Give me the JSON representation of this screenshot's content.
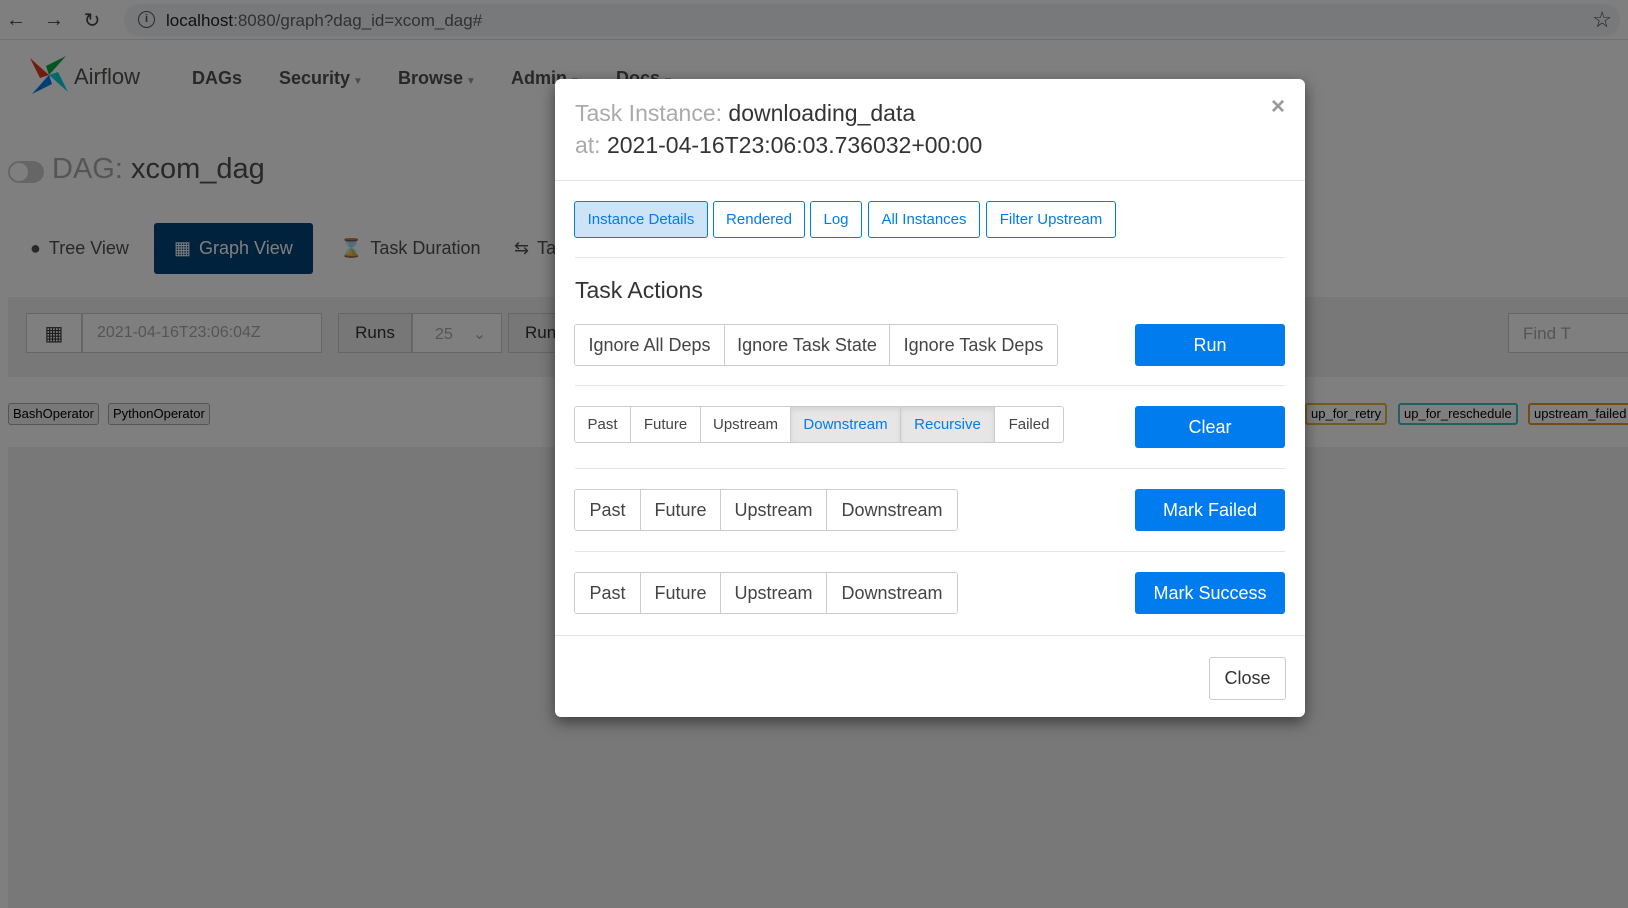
{
  "browser": {
    "url_host": "localhost",
    "url_rest": ":8080/graph?dag_id=xcom_dag#",
    "info_glyph": "i"
  },
  "navbar": {
    "brand": "Airflow",
    "items": [
      {
        "label": "DAGs",
        "dropdown": false
      },
      {
        "label": "Security",
        "dropdown": true
      },
      {
        "label": "Browse",
        "dropdown": true
      },
      {
        "label": "Admin",
        "dropdown": true
      },
      {
        "label": "Docs",
        "dropdown": true
      }
    ]
  },
  "dag": {
    "title_label": "DAG:",
    "title_value": "xcom_dag",
    "views": [
      {
        "label": "Tree View",
        "icon": "tree-icon"
      },
      {
        "label": "Graph View",
        "icon": "graph-icon"
      },
      {
        "label": "Task Duration",
        "icon": "hourglass-icon"
      },
      {
        "label": "Ta",
        "icon": "retry-icon"
      }
    ],
    "date_value": "2021-04-16T23:06:04Z",
    "runs_label": "Runs",
    "runs_value": "25",
    "run_label": "Run",
    "find_placeholder": "Find T",
    "operators": [
      "BashOperator",
      "PythonOperator"
    ],
    "states": [
      {
        "label": "up_for_retry",
        "color": "#e8b43a"
      },
      {
        "label": "up_for_reschedule",
        "color": "#40c0c0"
      },
      {
        "label": "upstream_failed",
        "color": "#e39a2a"
      }
    ]
  },
  "modal": {
    "title_label": "Task Instance:",
    "title_value": "downloading_data",
    "at_label": "at:",
    "at_value": "2021-04-16T23:06:03.736032+00:00",
    "close_x": "×",
    "tabs": [
      "Instance Details",
      "Rendered",
      "Log",
      "All Instances",
      "Filter Upstream"
    ],
    "section_title": "Task Actions",
    "run_options": [
      "Ignore All Deps",
      "Ignore Task State",
      "Ignore Task Deps"
    ],
    "run_label": "Run",
    "clear_options": [
      "Past",
      "Future",
      "Upstream",
      "Downstream",
      "Recursive",
      "Failed"
    ],
    "clear_label": "Clear",
    "failed_options": [
      "Past",
      "Future",
      "Upstream",
      "Downstream"
    ],
    "failed_label": "Mark Failed",
    "success_options": [
      "Past",
      "Future",
      "Upstream",
      "Downstream"
    ],
    "success_label": "Mark Success",
    "close_label": "Close"
  },
  "colors": {
    "primary": "#017cee",
    "active_view": "#00447a"
  }
}
